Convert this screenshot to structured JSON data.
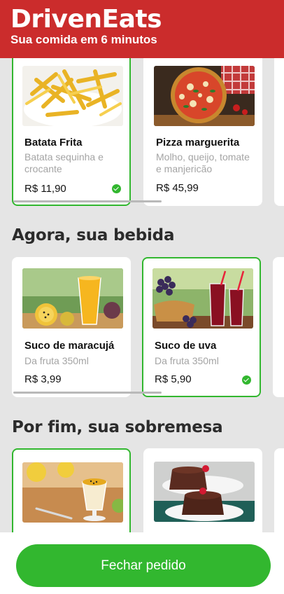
{
  "header": {
    "brand": "DrivenEats",
    "tagline": "Sua comida em 6 minutos"
  },
  "sections": {
    "drink_title": "Agora, sua bebida",
    "dessert_title": "Por fim, sua sobremesa"
  },
  "dishes": [
    {
      "name": "Batata Frita",
      "description": "Batata sequinha e crocante",
      "price": "R$ 11,90",
      "selected": true,
      "image_icon": "french-fries-image"
    },
    {
      "name": "Pizza marguerita",
      "description": "Molho, queijo, tomate e manjericão",
      "price": "R$ 45,99",
      "selected": false,
      "image_icon": "pizza-image"
    }
  ],
  "drinks": [
    {
      "name": "Suco de maracujá",
      "description": "Da fruta 350ml",
      "price": "R$ 3,99",
      "selected": false,
      "image_icon": "passion-fruit-juice-image"
    },
    {
      "name": "Suco de uva",
      "description": "Da fruta 350ml",
      "price": "R$ 5,90",
      "selected": true,
      "image_icon": "grape-juice-image"
    }
  ],
  "desserts": [
    {
      "name": "",
      "selected": true,
      "image_icon": "passion-fruit-mousse-image"
    },
    {
      "name": "",
      "selected": false,
      "image_icon": "chocolate-cake-image"
    }
  ],
  "footer": {
    "button_label": "Fechar pedido"
  },
  "colors": {
    "header": "#cb2c2c",
    "accent_green": "#32b72f",
    "background": "#e5e5e5"
  }
}
